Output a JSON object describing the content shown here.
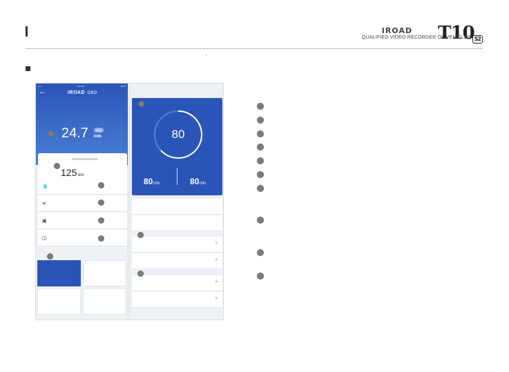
{
  "brand": {
    "logo": "IROAD",
    "model": "T10",
    "model_suffix": "S2",
    "tagline": "QUALIFIED VIDEO RECORDER OF VEHICLES"
  },
  "screen_efficiency": {
    "status_left": "•••••• ",
    "status_time": "9:41 AM",
    "status_battery": "100%",
    "title": "IROAD",
    "title_suffix": "OBD",
    "fuel_value": "24.7",
    "fuel_badge": "AVG",
    "fuel_unit": "KM/L",
    "distance_value": "125",
    "distance_unit": "km"
  },
  "screen_score": {
    "score": "80",
    "sub_left_value": "80",
    "sub_left_max": "/100",
    "sub_right_value": "80",
    "sub_right_max": "/100",
    "row_chevron": ">"
  },
  "colors": {
    "accent": "#2a55b8",
    "marker": "#7d7d7d"
  },
  "icons": [
    "back-arrow-icon",
    "fuel-drop-icon",
    "coolant-temp-icon",
    "fuel-pump-icon",
    "battery-icon",
    "chevron-right-icon"
  ]
}
